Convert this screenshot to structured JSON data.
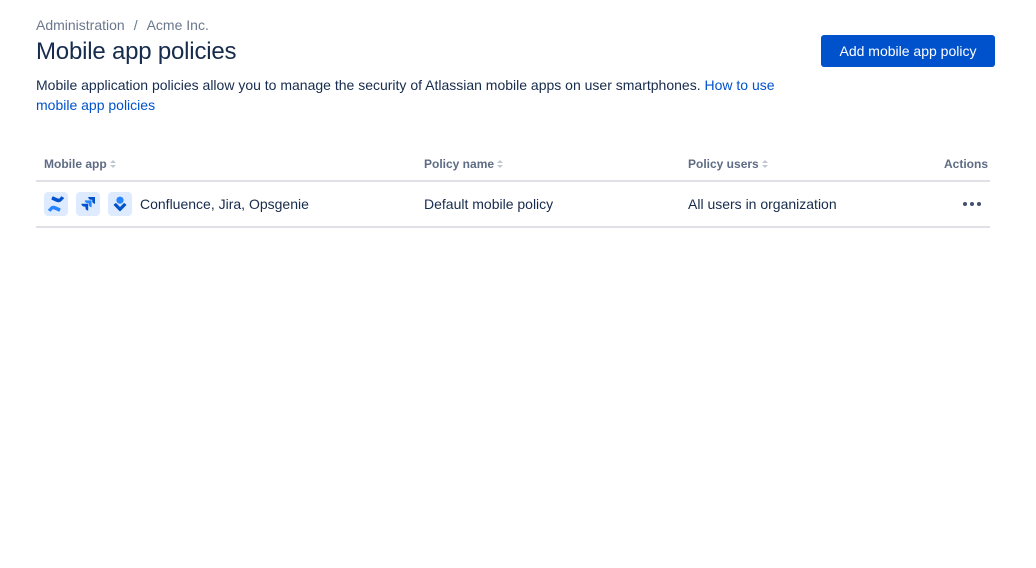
{
  "breadcrumb": {
    "items": [
      "Administration",
      "Acme Inc."
    ],
    "separator": "/"
  },
  "page": {
    "title": "Mobile app policies",
    "primary_button": "Add mobile app policy",
    "description": "Mobile application policies allow you to manage the security of Atlassian mobile apps on user smartphones.",
    "help_link": "How to use mobile app policies"
  },
  "table": {
    "columns": [
      {
        "label": "Mobile app",
        "sortable": true
      },
      {
        "label": "Policy name",
        "sortable": true
      },
      {
        "label": "Policy users",
        "sortable": true
      },
      {
        "label": "Actions",
        "sortable": false
      }
    ],
    "rows": [
      {
        "app_icons": [
          "confluence-icon",
          "jira-icon",
          "opsgenie-icon"
        ],
        "apps": "Confluence, Jira, Opsgenie",
        "policy_name": "Default mobile policy",
        "policy_users": "All users in organization",
        "actions_icon": "more-horizontal-icon"
      }
    ]
  },
  "colors": {
    "primary": "#0052CC",
    "text": "#172B4D",
    "subtle_text": "#6B778C",
    "icon_bg": "#DEEBFF",
    "icon_fg": "#2684FF",
    "border": "#DFE1E6"
  }
}
